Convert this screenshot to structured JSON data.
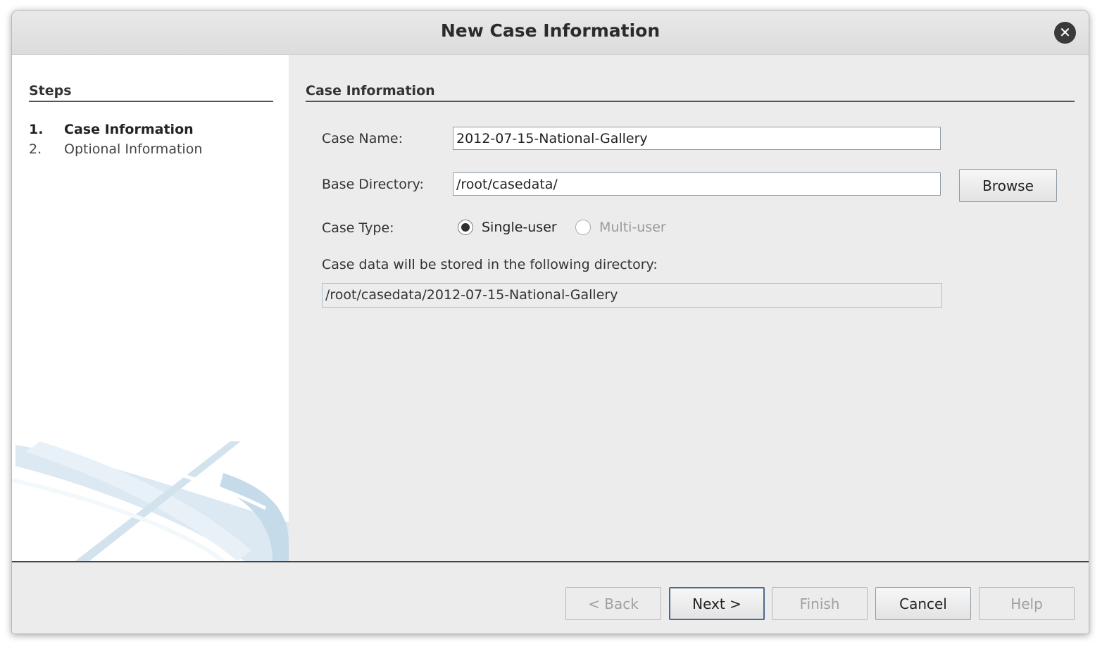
{
  "window": {
    "title": "New Case Information"
  },
  "sidebar": {
    "heading": "Steps",
    "steps": [
      {
        "num": "1.",
        "label": "Case Information",
        "active": true
      },
      {
        "num": "2.",
        "label": "Optional Information",
        "active": false
      }
    ]
  },
  "main": {
    "section_title": "Case Information",
    "case_name": {
      "label": "Case Name:",
      "value": "2012-07-15-National-Gallery"
    },
    "base_directory": {
      "label": "Base Directory:",
      "value": "/root/casedata/",
      "browse_label": "Browse"
    },
    "case_type": {
      "label": "Case Type:",
      "options": [
        {
          "label": "Single-user",
          "checked": true,
          "enabled": true
        },
        {
          "label": "Multi-user",
          "checked": false,
          "enabled": false
        }
      ]
    },
    "storage": {
      "label": "Case data will be stored in the following directory:",
      "path": "/root/casedata/2012-07-15-National-Gallery"
    }
  },
  "footer": {
    "back_label": "< Back",
    "next_label": "Next >",
    "finish_label": "Finish",
    "cancel_label": "Cancel",
    "help_label": "Help"
  },
  "icons": {
    "close": "close-icon",
    "radio": "radio-icon"
  }
}
